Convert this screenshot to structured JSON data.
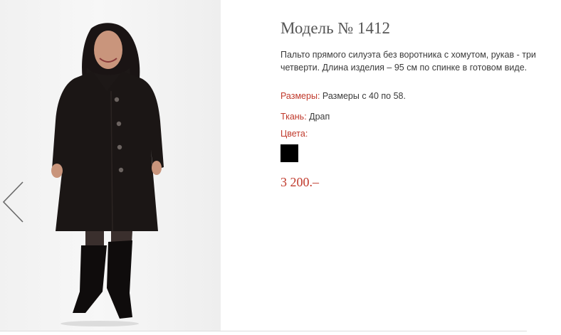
{
  "product": {
    "title": "Модель № 1412",
    "description": "Пальто прямого силуэта без воротника с хомутом, рукав - три четверти. Длина изделия – 95 см по спинке в готовом виде.",
    "sizes_label": "Размеры:",
    "sizes_value": " Размеры с 40 по 58.",
    "fabric_label": "Ткань:",
    "fabric_value": " Драп",
    "colors_label": "Цвета:",
    "colors": [
      "#000000"
    ],
    "price": "3 200.–"
  },
  "gallery": {
    "prev_icon": "chevron-left-icon",
    "photo": "woman-in-black-coat-photo"
  },
  "colors": {
    "accent": "#c0392b",
    "title": "#555555",
    "text": "#3a3a3a"
  }
}
